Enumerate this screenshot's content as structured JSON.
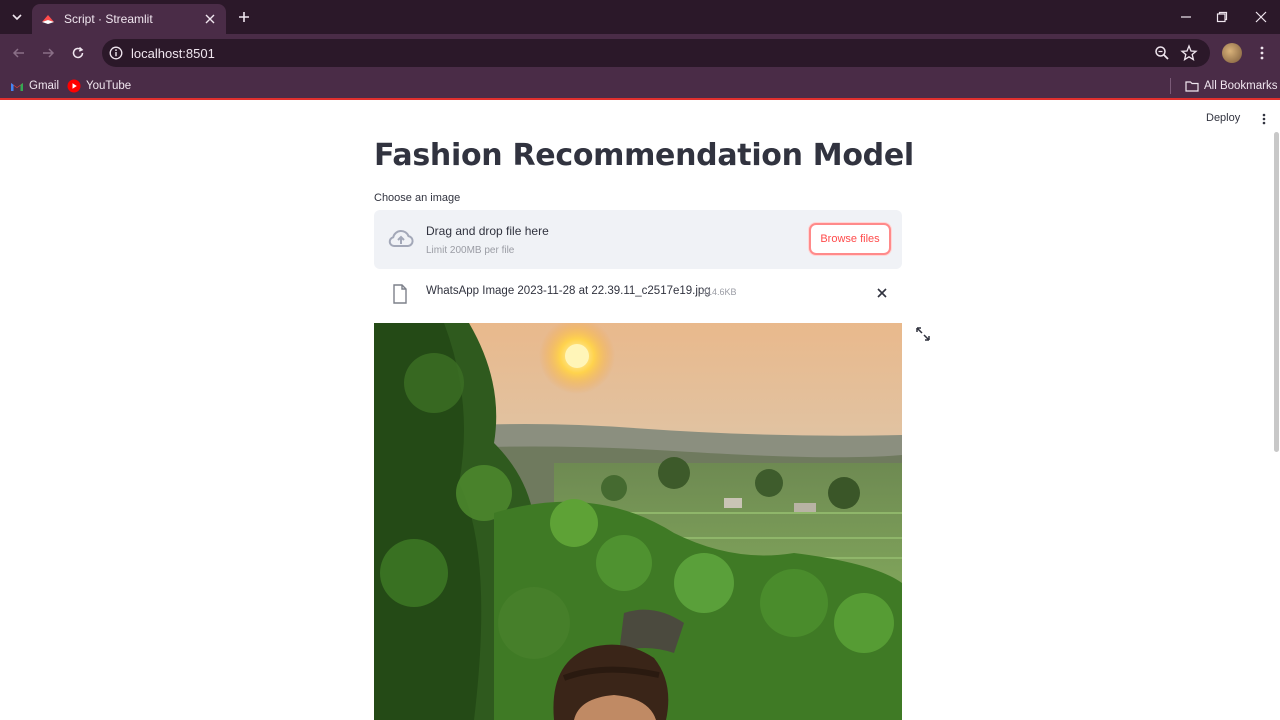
{
  "browser": {
    "tab_title": "Script · Streamlit",
    "url": "localhost:8501",
    "bookmarks": [
      {
        "label": "Gmail",
        "icon": "gmail-icon"
      },
      {
        "label": "YouTube",
        "icon": "youtube-icon"
      }
    ],
    "all_bookmarks_label": "All Bookmarks"
  },
  "app": {
    "deploy_label": "Deploy",
    "title": "Fashion Recommendation Model",
    "uploader": {
      "label": "Choose an image",
      "drop_text": "Drag and drop file here",
      "limit_text": "Limit 200MB per file",
      "browse_label": "Browse files"
    },
    "uploaded_file": {
      "name": "WhatsApp Image 2023-11-28 at 22.39.11_c2517e19.jpg",
      "size": "414.6KB"
    },
    "image": {
      "description_icon": "landscape-portrait-photo"
    }
  },
  "colors": {
    "chrome_dark": "#2b1829",
    "chrome_light": "#4a2c47",
    "streamlit_accent": "#ff4b4b",
    "text": "#31333f"
  }
}
